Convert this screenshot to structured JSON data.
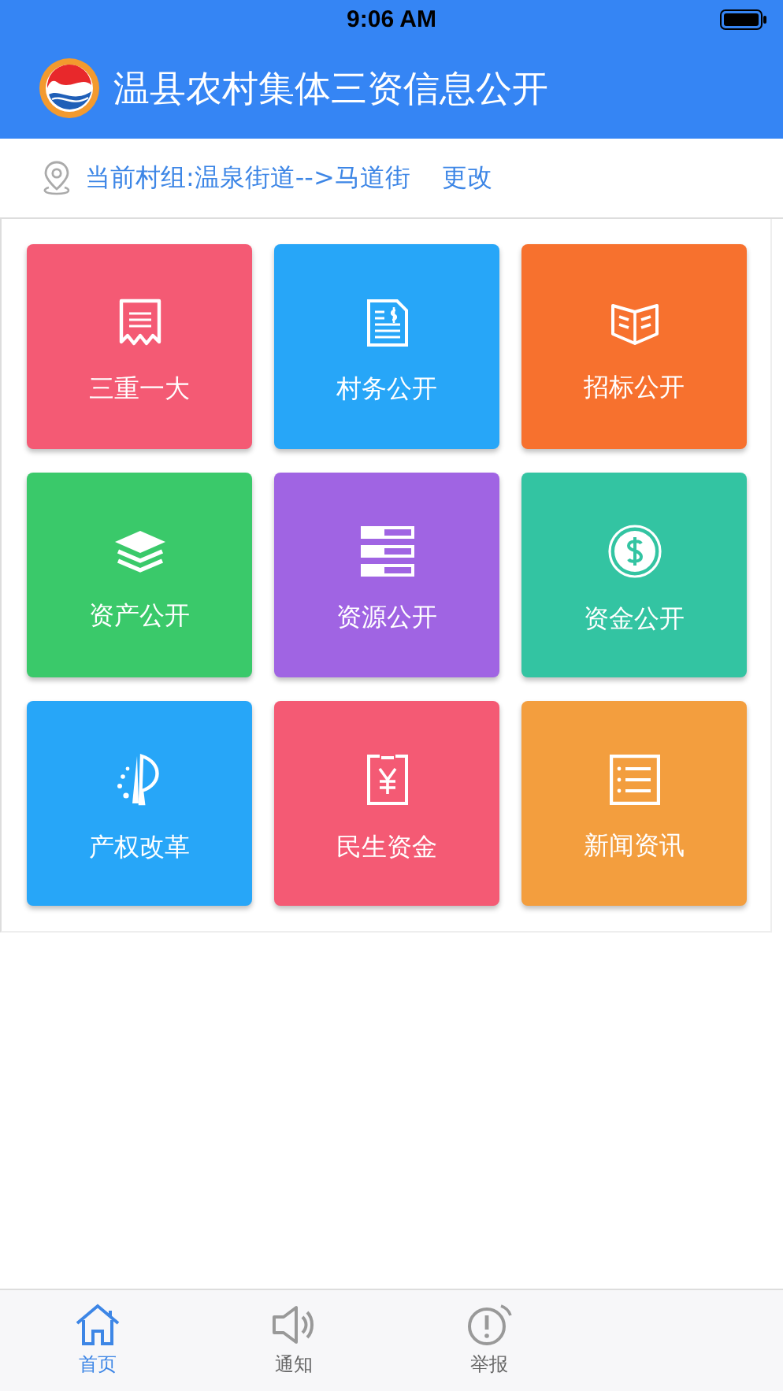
{
  "status_bar": {
    "time": "9:06 AM"
  },
  "header": {
    "title": "温县农村集体三资信息公开"
  },
  "location": {
    "text": "当前村组:温泉街道-->马道街",
    "action": "更改"
  },
  "tiles": [
    {
      "label": "三重一大",
      "color": "#f45a74"
    },
    {
      "label": "村务公开",
      "color": "#27a6f8"
    },
    {
      "label": "招标公开",
      "color": "#f7712e"
    },
    {
      "label": "资产公开",
      "color": "#3ac96a"
    },
    {
      "label": "资源公开",
      "color": "#a064e3"
    },
    {
      "label": "资金公开",
      "color": "#33c4a2"
    },
    {
      "label": "产权改革",
      "color": "#27a6f8"
    },
    {
      "label": "民生资金",
      "color": "#f45a74"
    },
    {
      "label": "新闻资讯",
      "color": "#f39e3e"
    }
  ],
  "tab_bar": [
    {
      "label": "首页",
      "selected": true
    },
    {
      "label": "通知",
      "selected": false
    },
    {
      "label": "举报",
      "selected": false
    }
  ]
}
